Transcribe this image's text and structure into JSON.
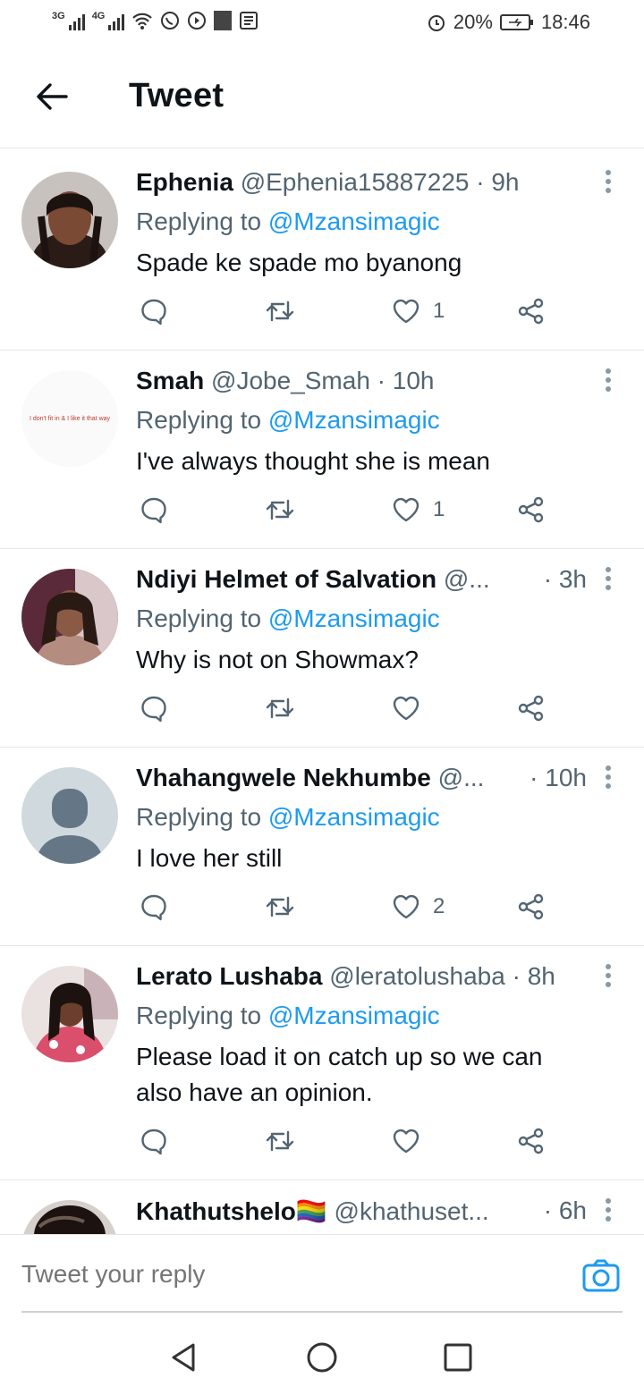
{
  "status": {
    "network1": "3G",
    "network2": "4G",
    "battery": "20%",
    "time": "18:46"
  },
  "header": {
    "title": "Tweet"
  },
  "tweets": [
    {
      "name": "Ephenia",
      "handle": "@Ephenia15887225",
      "time": "· 9h",
      "replying_label": "Replying to",
      "mention": "@Mzansimagic",
      "text": "Spade ke spade mo byanong",
      "likes": "1"
    },
    {
      "name": "Smah",
      "handle": "@Jobe_Smah",
      "time": "· 10h",
      "replying_label": "Replying to",
      "mention": "@Mzansimagic",
      "text": "I've always thought she is mean",
      "likes": "1",
      "avatar_text": "I don't fit in & I like it that way"
    },
    {
      "name": "Ndiyi Helmet of Salvation",
      "handle": "@...",
      "time": "· 3h",
      "replying_label": "Replying to",
      "mention": "@Mzansimagic",
      "text": "Why is not on Showmax?",
      "likes": ""
    },
    {
      "name": "Vhahangwele Nekhumbe",
      "handle": "@...",
      "time": "· 10h",
      "replying_label": "Replying to",
      "mention": "@Mzansimagic",
      "text": "I love her still",
      "likes": "2"
    },
    {
      "name": "Lerato Lushaba",
      "handle": "@leratolushaba",
      "time": "· 8h",
      "replying_label": "Replying to",
      "mention": "@Mzansimagic",
      "text": "Please load it on catch up so we can also have an opinion.",
      "likes": ""
    },
    {
      "name": "Khathutshelo🏳️‍🌈",
      "handle": "@khathuset...",
      "time": "· 6h",
      "replying_label": "",
      "mention": "",
      "text": "",
      "likes": ""
    }
  ],
  "reply_bar": {
    "placeholder": "Tweet your reply"
  },
  "colors": {
    "accent": "#1d9bf0",
    "muted": "#536471",
    "divider": "#e6e6e6"
  }
}
